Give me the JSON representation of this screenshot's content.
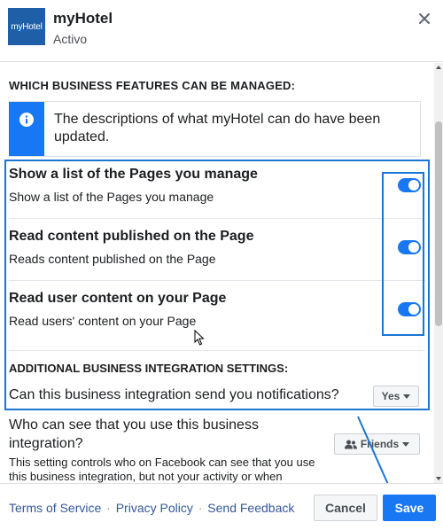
{
  "header": {
    "logo_text": "myHotel",
    "app_name": "myHotel",
    "status": "Activo",
    "close_icon": "close-icon"
  },
  "main": {
    "section_title": "WHICH BUSINESS FEATURES CAN BE MANAGED:",
    "notice": {
      "icon": "info-icon",
      "text": "The descriptions of what myHotel can do have been updated."
    },
    "permissions": [
      {
        "title": "Show a list of the Pages you manage",
        "description": "Show a list of the Pages you manage",
        "enabled": true
      },
      {
        "title": "Read content published on the Page",
        "description": "Reads content published on the Page",
        "enabled": true
      },
      {
        "title": "Read user content on your Page",
        "description": "Read users' content on your Page",
        "enabled": true
      }
    ],
    "additional_title": "ADDITIONAL BUSINESS INTEGRATION SETTINGS:",
    "notifications": {
      "question": "Can this business integration send you notifications?",
      "value": "Yes"
    },
    "visibility": {
      "question": "Who can see that you use this business integration?",
      "value": "Friends",
      "icon": "friends-icon",
      "description": "This setting controls who on Facebook can see that you use this business integration, but not your activity or when"
    }
  },
  "footer": {
    "links": [
      "Terms of Service",
      "Privacy Policy",
      "Send Feedback"
    ],
    "separator": "·",
    "cancel_label": "Cancel",
    "save_label": "Save"
  },
  "colors": {
    "brand_blue": "#1877f2",
    "highlight_outline": "#1a76d2",
    "logo_bg": "#1e5fa8"
  }
}
